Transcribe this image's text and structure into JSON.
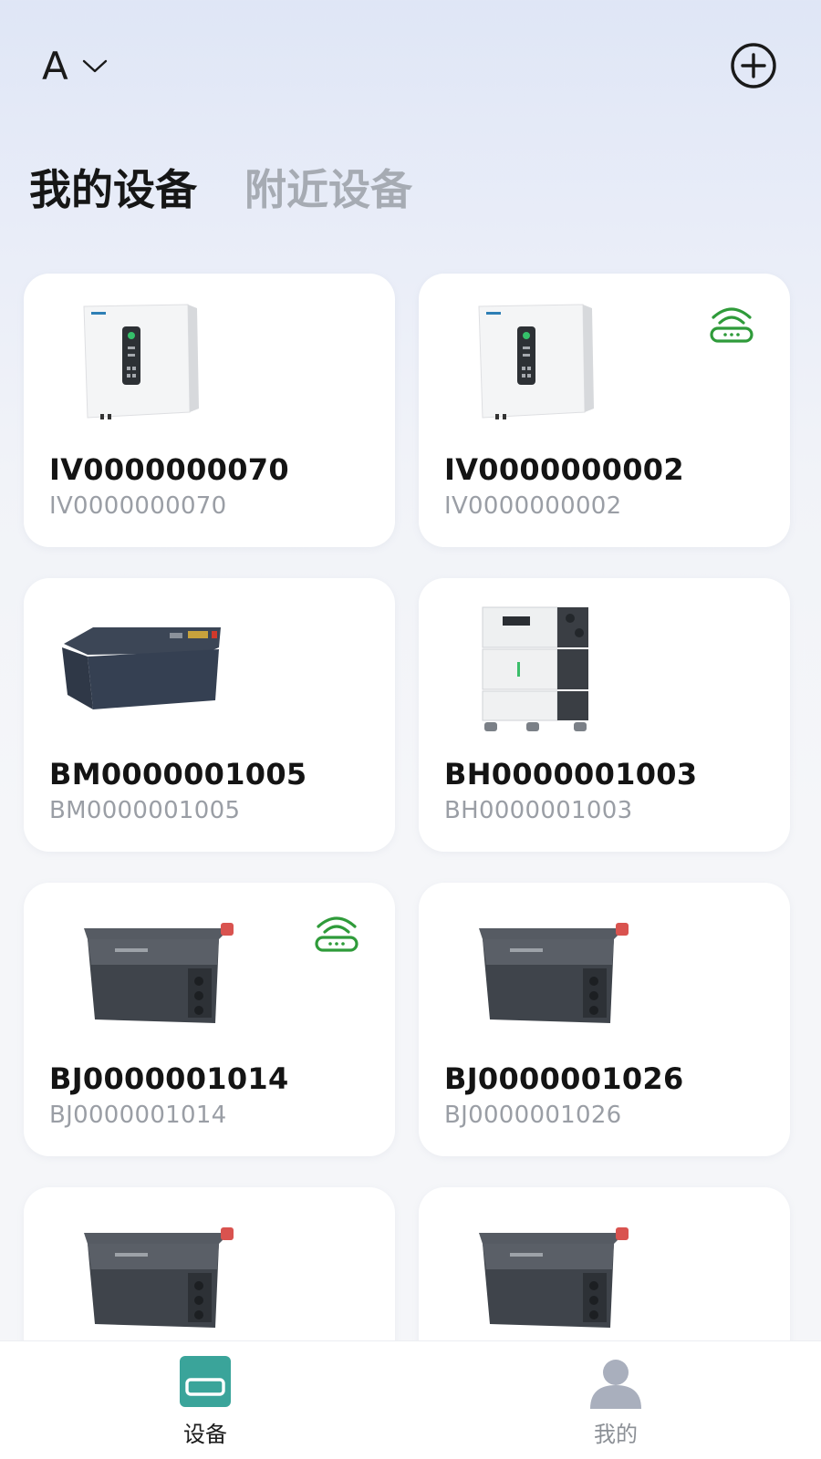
{
  "header": {
    "account_name": "A",
    "account_dropdown_icon": "chevron-down-icon",
    "add_icon": "plus-circle-icon"
  },
  "tabs": [
    {
      "label": "我的设备",
      "active": true
    },
    {
      "label": "附近设备",
      "active": false
    }
  ],
  "devices": [
    {
      "title": "IV0000000070",
      "subtitle": "IV0000000070",
      "image": "inverter",
      "wifi": false
    },
    {
      "title": "IV0000000002",
      "subtitle": "IV0000000002",
      "image": "inverter",
      "wifi": true
    },
    {
      "title": "BM0000001005",
      "subtitle": "BM0000001005",
      "image": "battery-module",
      "wifi": false
    },
    {
      "title": "BH0000001003",
      "subtitle": "BH0000001003",
      "image": "battery-stack",
      "wifi": false
    },
    {
      "title": "BJ0000001014",
      "subtitle": "BJ0000001014",
      "image": "portable-power-station",
      "wifi": true
    },
    {
      "title": "BJ0000001026",
      "subtitle": "BJ0000001026",
      "image": "portable-power-station",
      "wifi": false
    },
    {
      "title": "",
      "subtitle": "",
      "image": "portable-power-station",
      "wifi": false
    },
    {
      "title": "",
      "subtitle": "",
      "image": "portable-power-station",
      "wifi": false
    }
  ],
  "bottom_nav": [
    {
      "label": "设备",
      "icon": "device-icon",
      "active": true
    },
    {
      "label": "我的",
      "icon": "user-icon",
      "active": false
    }
  ],
  "colors": {
    "wifi_online": "#2f9b3a",
    "nav_active": "#3aa49a",
    "nav_inactive": "#a9afbd"
  }
}
